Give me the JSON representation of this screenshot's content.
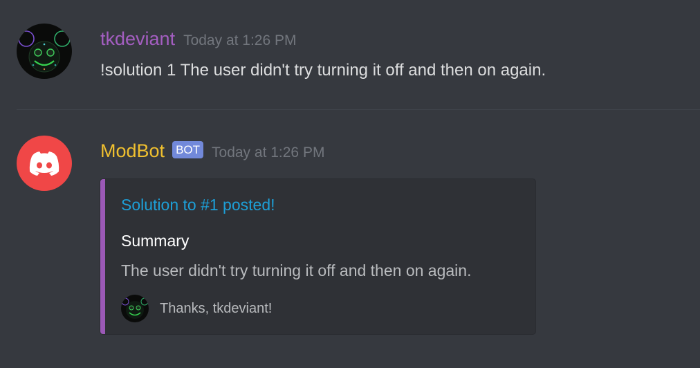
{
  "messages": [
    {
      "author": "tkdeviant",
      "author_color": "#a45ec1",
      "timestamp": "Today at 1:26 PM",
      "avatar_icon": "deadmau5-avatar",
      "content": "!solution 1 The user didn't try turning it off and then on again."
    },
    {
      "author": "ModBot",
      "author_color": "#f0c02f",
      "bot_tag": "BOT",
      "bot_tag_color": "#7289da",
      "timestamp": "Today at 1:26 PM",
      "avatar_icon": "discord-logo-avatar",
      "avatar_color": "#f04747",
      "embed": {
        "accent_color": "#9b59b6",
        "title": "Solution to #1 posted!",
        "field_name": "Summary",
        "field_value": "The user didn't try turning it off and then on again.",
        "footer_icon": "deadmau5-avatar",
        "footer_text": "Thanks, tkdeviant!"
      }
    }
  ]
}
